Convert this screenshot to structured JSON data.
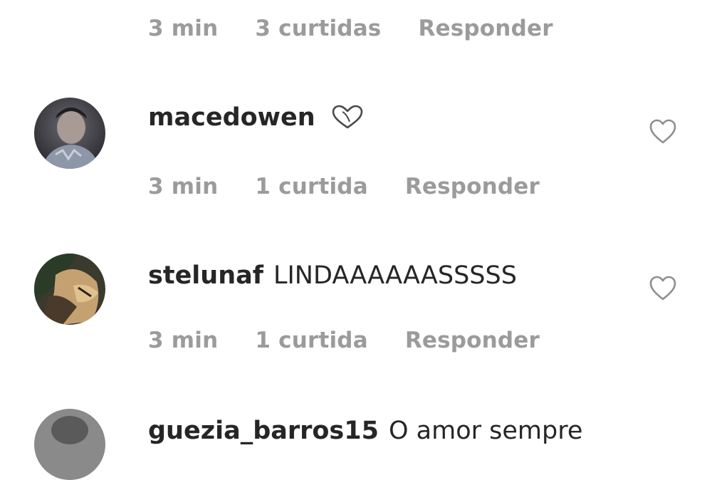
{
  "comments": [
    {
      "username": "",
      "text": "",
      "time": "3 min",
      "likes": "3 curtidas",
      "reply_label": "Responder"
    },
    {
      "username": "macedowen",
      "text": "",
      "has_inline_heart_emoji": true,
      "time": "3 min",
      "likes": "1 curtida",
      "reply_label": "Responder"
    },
    {
      "username": "stelunaf",
      "text": "LINDAAAAAASSSSS",
      "time": "3 min",
      "likes": "1 curtida",
      "reply_label": "Responder"
    },
    {
      "username": "guezia_barros15",
      "text": "O amor sempre"
    }
  ],
  "icons": {
    "like": "heart-outline-icon",
    "emoji": "heart-emoji-icon"
  },
  "colors": {
    "meta_text": "#9b9b9b",
    "body_text": "#262626",
    "icon_stroke": "#8e8e8e"
  }
}
